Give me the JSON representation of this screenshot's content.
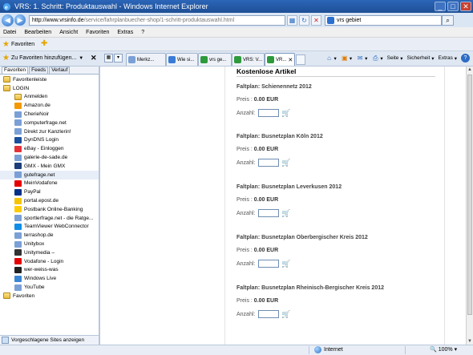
{
  "window": {
    "title": "VRS: 1. Schritt: Produktauswahl - Windows Internet Explorer"
  },
  "address": {
    "host": "http://www.vrsinfo.de",
    "path": "/service/fahrplanbuecher-shop/1-schritt-produktauswahl.html"
  },
  "search": {
    "value": "vrs gebiet"
  },
  "menu": [
    "Datei",
    "Bearbeiten",
    "Ansicht",
    "Favoriten",
    "Extras",
    "?"
  ],
  "favbar": {
    "label": "Favoriten"
  },
  "sidebar": {
    "add_label": "Zu Favoriten hinzufügen...",
    "tabs": [
      "Favoriten",
      "Feeds",
      "Verlauf"
    ],
    "items": [
      {
        "label": "Favoritenleiste",
        "icon": "folder-icon",
        "child": false
      },
      {
        "label": "LOGIN",
        "icon": "folder-icon",
        "child": false
      },
      {
        "label": "Anmelden",
        "icon": "folder-icon",
        "child": true
      },
      {
        "label": "Amazon.de",
        "icon": "amazon-icon",
        "child": true
      },
      {
        "label": "CherieNoir",
        "icon": "page-icon",
        "child": true
      },
      {
        "label": "computerfrage.net",
        "icon": "page-icon",
        "child": true
      },
      {
        "label": "Direkt zur Kanzlerin!",
        "icon": "page-icon",
        "child": true
      },
      {
        "label": "DynDNS Login",
        "icon": "dyndns-icon",
        "child": true
      },
      {
        "label": "eBay - Einloggen",
        "icon": "ebay-icon",
        "child": true
      },
      {
        "label": "galerie-de-sade.de",
        "icon": "page-icon",
        "child": true
      },
      {
        "label": "GMX - Mein GMX",
        "icon": "gmx-icon",
        "child": true
      },
      {
        "label": "gutefrage.net",
        "icon": "page-icon",
        "child": true
      },
      {
        "label": "MeinVodafone",
        "icon": "vodafone-icon",
        "child": true
      },
      {
        "label": "PayPal",
        "icon": "paypal-icon",
        "child": true
      },
      {
        "label": "portal.epost.de",
        "icon": "epost-icon",
        "child": true
      },
      {
        "label": "Postbank Online-Banking",
        "icon": "postbank-icon",
        "child": true
      },
      {
        "label": "sportlerfrage.net - die Ratge...",
        "icon": "page-icon",
        "child": true
      },
      {
        "label": "TeamViewer WebConnector",
        "icon": "teamviewer-icon",
        "child": true
      },
      {
        "label": "terrashop.de",
        "icon": "page-icon",
        "child": true
      },
      {
        "label": "Unitybox",
        "icon": "page-icon",
        "child": true
      },
      {
        "label": "Unitymedia –",
        "icon": "unitymedia-icon",
        "child": true
      },
      {
        "label": "Vodafone - Login",
        "icon": "vodafone-icon",
        "child": true
      },
      {
        "label": "wer-weiss-was",
        "icon": "www-icon",
        "child": true
      },
      {
        "label": "Windows Live",
        "icon": "windows-live-icon",
        "child": true
      },
      {
        "label": "YouTube",
        "icon": "page-icon",
        "child": true
      },
      {
        "label": "Favoriten",
        "icon": "folder-icon",
        "child": false
      }
    ],
    "footer": "Vorgeschlagene Sites anzeigen"
  },
  "tabs": [
    "Merkz...",
    "Wie si...",
    "vrs ge...",
    "VRS: V...",
    "VR..."
  ],
  "commands": {
    "page": "Seite",
    "security": "Sicherheit",
    "tools": "Extras"
  },
  "content": {
    "heading": "Kostenlose Artikel",
    "price_label": "Preis :",
    "qty_label": "Anzahl:",
    "products": [
      {
        "name": "Faltplan: Schienennetz 2012",
        "price": "0.00 EUR"
      },
      {
        "name": "Faltplan: Busnetzplan Köln 2012",
        "price": "0.00 EUR"
      },
      {
        "name": "Faltplan: Busnetzplan Leverkusen 2012",
        "price": "0.00 EUR"
      },
      {
        "name": "Faltplan: Busnetzplan Oberbergischer Kreis 2012",
        "price": "0.00 EUR"
      },
      {
        "name": "Faltplan: Busnetzplan Rheinisch-Bergischer Kreis 2012",
        "price": "0.00 EUR"
      }
    ]
  },
  "status": {
    "zone": "Internet",
    "zoom": "100%"
  }
}
